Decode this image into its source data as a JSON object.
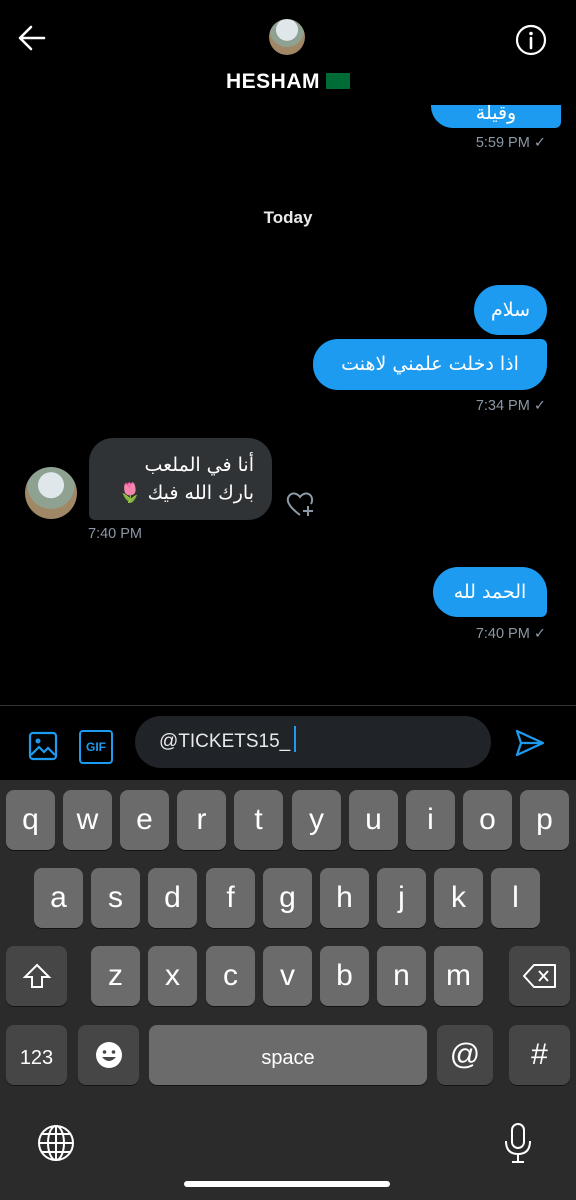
{
  "header": {
    "name": "HESHAM",
    "flag": "🇸🇦",
    "back_icon": "arrow-left-icon",
    "info_icon": "info-icon"
  },
  "messages": {
    "partial_bubble_text": "وقيلة",
    "t1": "5:59 PM ✓",
    "date_label": "Today",
    "m1": "سلام",
    "m2": "اذا دخلت علمني لاهنت",
    "t2": "7:34 PM ✓",
    "in_line1": "أنا في الملعب",
    "in_line2": "بارك الله فيك 🌷",
    "t3": "7:40 PM",
    "m3": "الحمد لله",
    "t4": "7:40 PM ✓"
  },
  "composer": {
    "image_icon": "image-icon",
    "gif_label": "GIF",
    "input_value": "@TICKETS15_",
    "send_icon": "send-icon"
  },
  "keyboard": {
    "row1": [
      "q",
      "w",
      "e",
      "r",
      "t",
      "y",
      "u",
      "i",
      "o",
      "p"
    ],
    "row2": [
      "a",
      "s",
      "d",
      "f",
      "g",
      "h",
      "j",
      "k",
      "l"
    ],
    "row3": [
      "z",
      "x",
      "c",
      "v",
      "b",
      "n",
      "m"
    ],
    "shift_icon": "shift-icon",
    "backspace_icon": "backspace-icon",
    "num_label": "123",
    "emoji_icon": "emoji-icon",
    "space_label": "space",
    "at_label": "@",
    "hash_label": "#",
    "globe_icon": "globe-icon",
    "mic_icon": "microphone-icon"
  }
}
